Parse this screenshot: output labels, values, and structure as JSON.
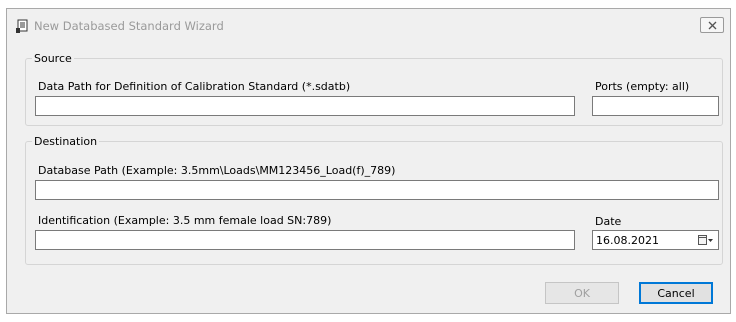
{
  "window": {
    "title": "New Databased Standard Wizard",
    "close_label": "close"
  },
  "source": {
    "legend": "Source",
    "data_path_label": "Data Path for Definition of Calibration Standard (*.sdatb)",
    "data_path_value": "",
    "ports_label": "Ports (empty: all)",
    "ports_value": ""
  },
  "destination": {
    "legend": "Destination",
    "database_path_label": "Database Path (Example: 3.5mm\\Loads\\MM123456_Load(f)_789)",
    "database_path_value": "",
    "identification_label": "Identification (Example: 3.5 mm female load SN:789)",
    "identification_value": "",
    "date_label": "Date",
    "date_value": "16.08.2021"
  },
  "buttons": {
    "ok_label": "OK",
    "cancel_label": "Cancel"
  },
  "icons": {
    "title": "document-icon",
    "close": "close-icon",
    "date_picker": "calendar-dropdown-icon"
  },
  "colors": {
    "title_text": "#9a9a9a",
    "default_button_border": "#0078d7"
  }
}
